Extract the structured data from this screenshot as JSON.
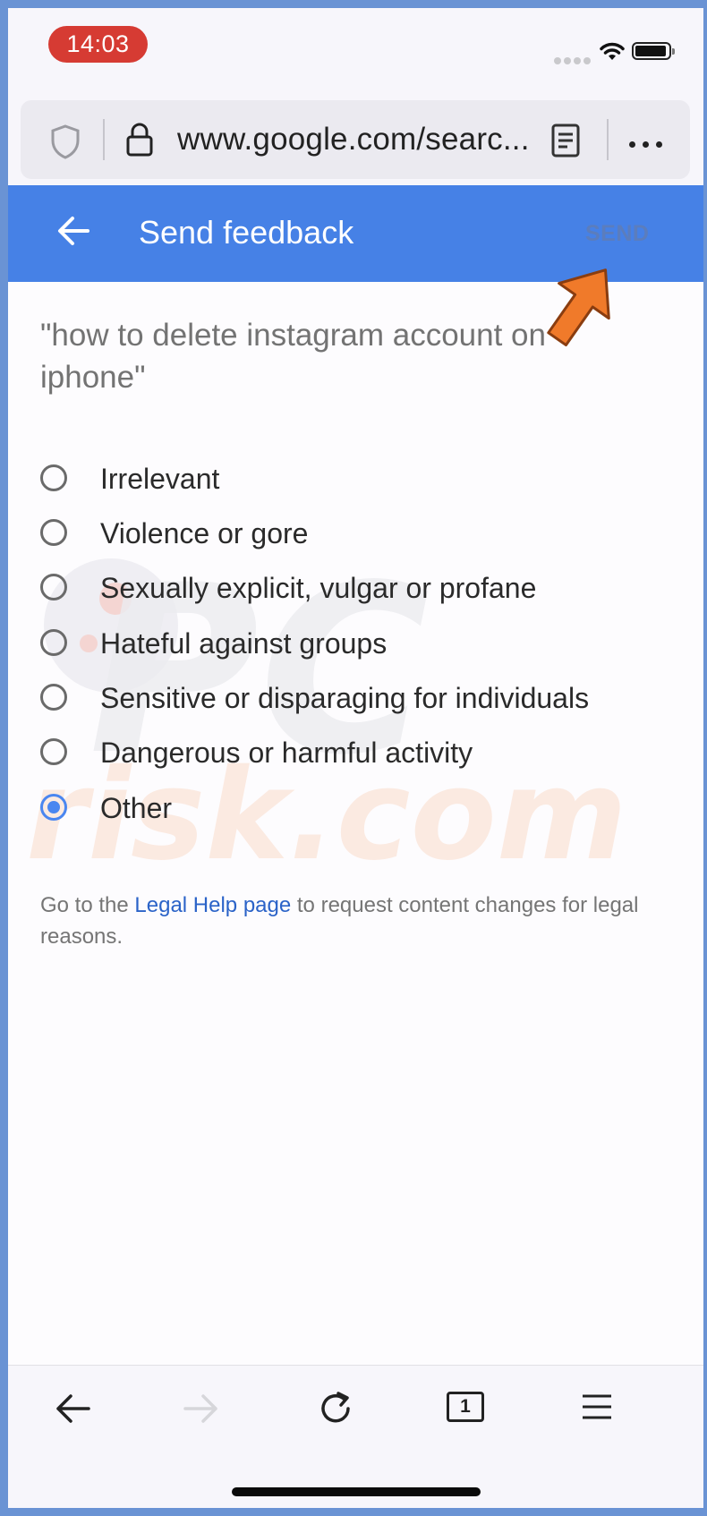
{
  "status": {
    "time": "14:03"
  },
  "browser": {
    "url": "www.google.com/searc..."
  },
  "header": {
    "title": "Send feedback",
    "send_label": "SEND"
  },
  "content": {
    "query": "\"how to delete instagram account on iphone\"",
    "options": [
      {
        "label": "Irrelevant",
        "checked": false
      },
      {
        "label": "Violence or gore",
        "checked": false
      },
      {
        "label": "Sexually explicit, vulgar or profane",
        "checked": false
      },
      {
        "label": "Hateful against groups",
        "checked": false
      },
      {
        "label": "Sensitive or disparaging for individuals",
        "checked": false
      },
      {
        "label": "Dangerous or harmful activity",
        "checked": false
      },
      {
        "label": "Other",
        "checked": true
      }
    ],
    "legal": {
      "prefix": "Go to the ",
      "link": "Legal Help page",
      "suffix": " to request content changes for legal reasons."
    }
  },
  "toolbar": {
    "tab_count": "1"
  },
  "watermark": {
    "line1": "PC",
    "line2": "risk.com"
  },
  "colors": {
    "header": "#4681e6",
    "radio_checked": "#4a86f0",
    "pointer": "#f07a2a",
    "link": "#2b63c8"
  }
}
